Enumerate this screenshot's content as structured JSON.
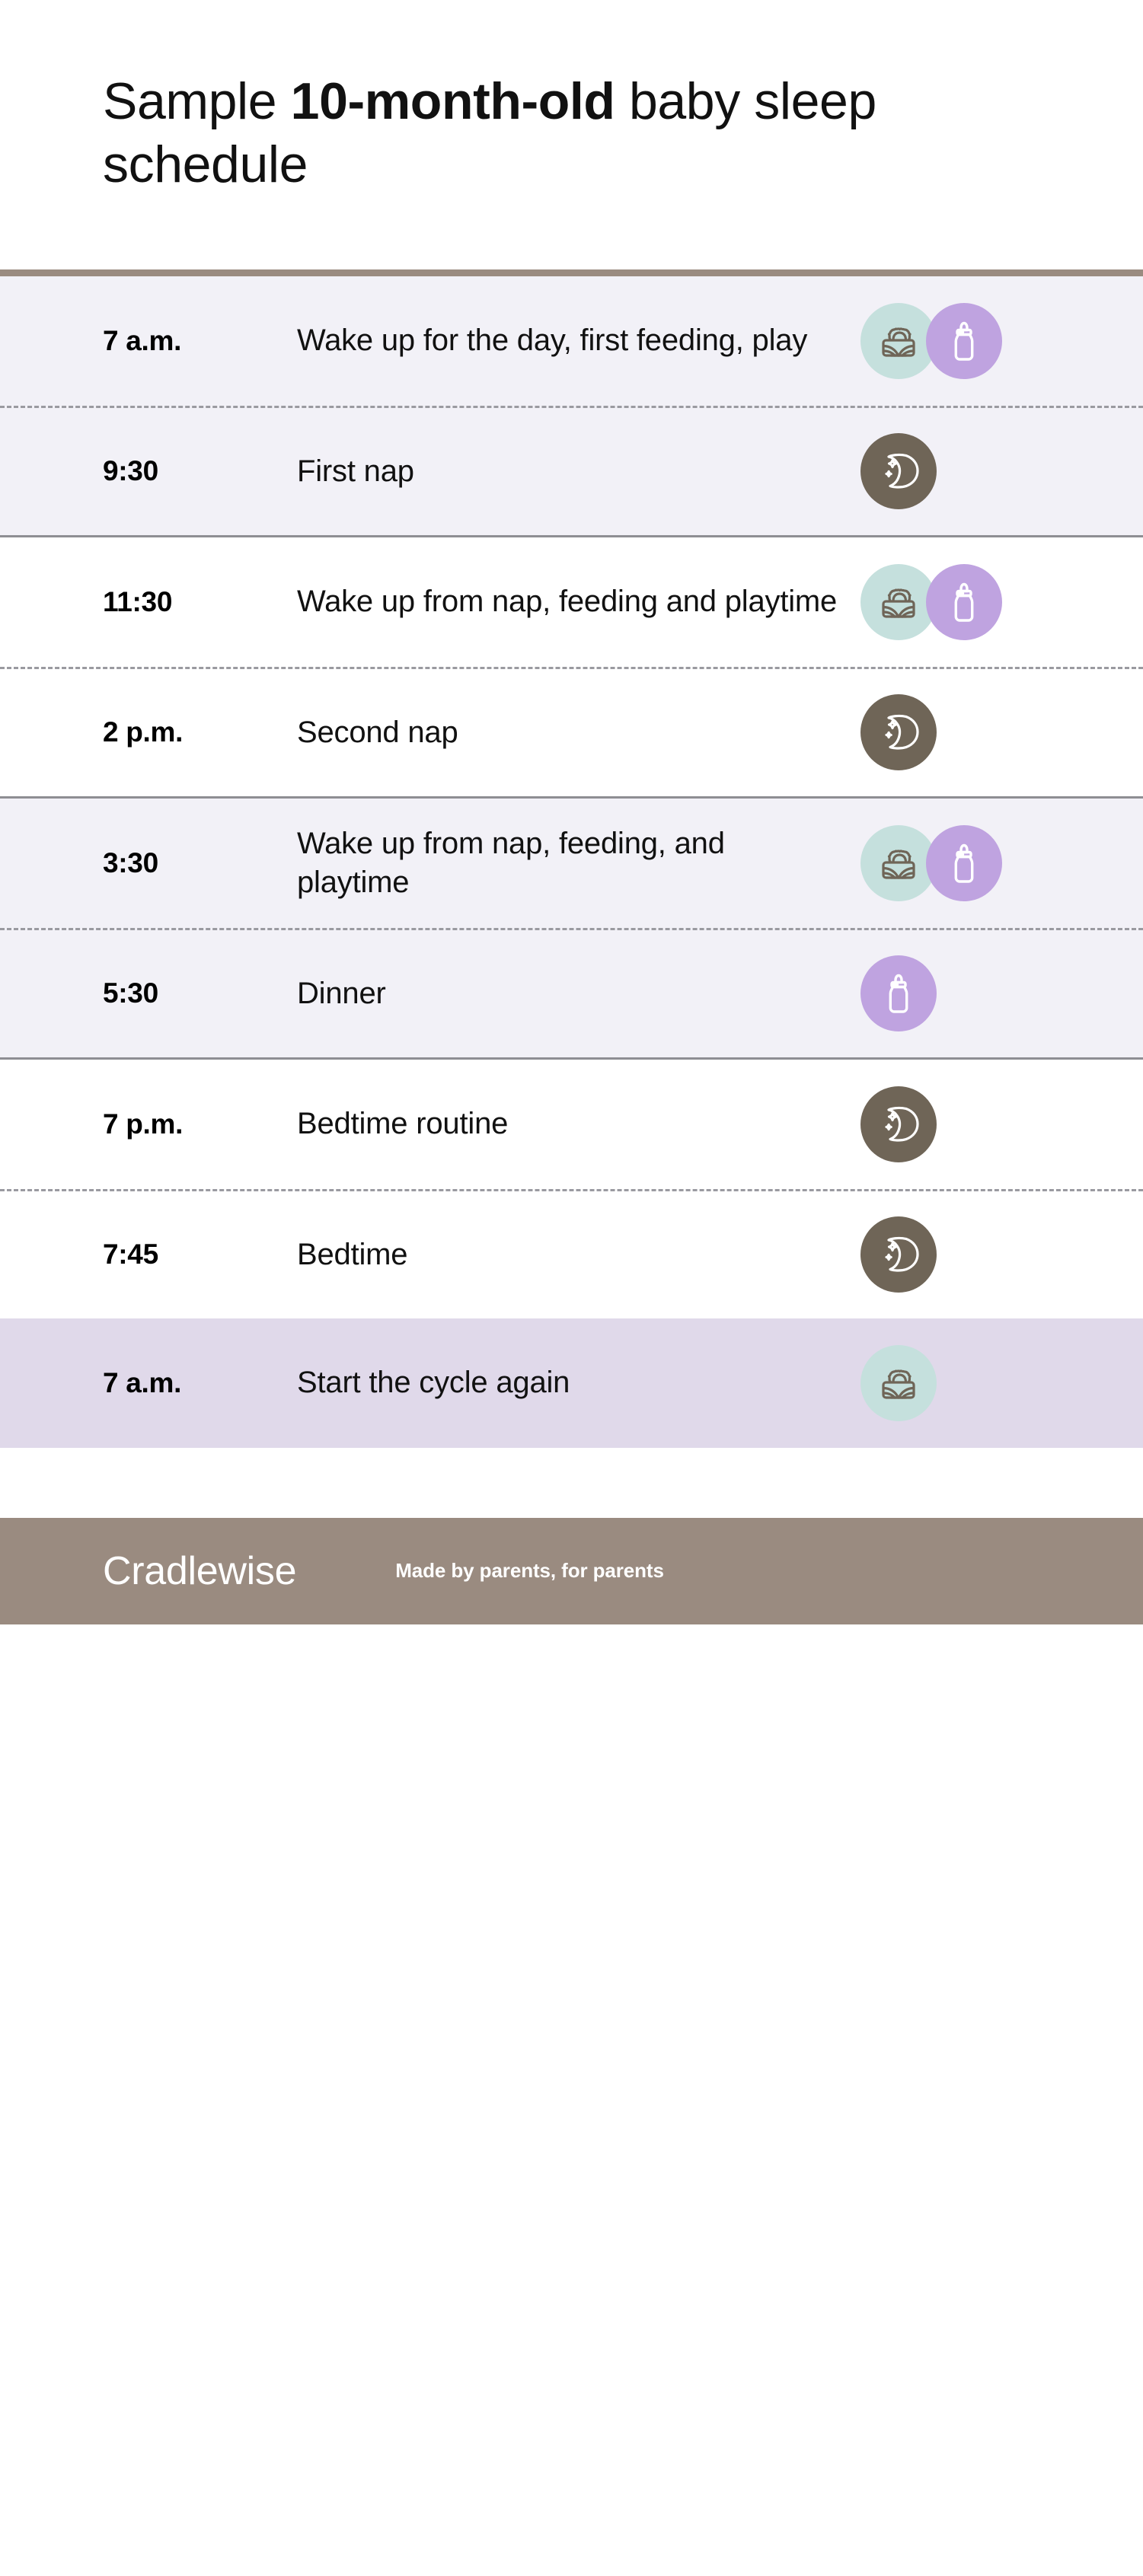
{
  "header": {
    "title_prefix": "Sample ",
    "title_bold": "10-month-old",
    "title_suffix": " baby sleep schedule"
  },
  "schedule": {
    "groups": [
      {
        "style": "shaded",
        "rows": [
          {
            "time": "7 a.m.",
            "description": "Wake up for the day, first feeding, play",
            "icons": [
              "sunrise-icon",
              "bottle-icon"
            ]
          },
          {
            "time": "9:30",
            "description": "First nap",
            "icons": [
              "moon-icon"
            ]
          }
        ]
      },
      {
        "style": "plain",
        "rows": [
          {
            "time": "11:30",
            "description": "Wake up from nap, feeding and playtime",
            "icons": [
              "sunrise-icon",
              "bottle-icon"
            ]
          },
          {
            "time": "2 p.m.",
            "description": "Second nap",
            "icons": [
              "moon-icon"
            ]
          }
        ]
      },
      {
        "style": "shaded",
        "rows": [
          {
            "time": "3:30",
            "description": "Wake up from nap, feeding, and playtime",
            "icons": [
              "sunrise-icon",
              "bottle-icon"
            ]
          },
          {
            "time": "5:30",
            "description": "Dinner",
            "icons": [
              "bottle-icon"
            ]
          }
        ]
      },
      {
        "style": "plain",
        "rows": [
          {
            "time": "7 p.m.",
            "description": "Bedtime routine",
            "icons": [
              "moon-icon"
            ]
          },
          {
            "time": "7:45",
            "description": "Bedtime",
            "icons": [
              "moon-icon"
            ]
          }
        ]
      },
      {
        "style": "accent",
        "rows": [
          {
            "time": "7 a.m.",
            "description": "Start the cycle again",
            "icons": [
              "sunrise-icon"
            ]
          }
        ]
      }
    ]
  },
  "footer": {
    "brand": "Cradlewise",
    "tagline": "Made by parents, for parents"
  },
  "colors": {
    "rule_brown": "#9a8b80",
    "row_shaded": "#f2f1f7",
    "row_accent": "#e0d9ea",
    "badge_mint": "#c5e0dd",
    "badge_purple": "#bfa3e0",
    "badge_brown": "#6f6557",
    "separator_solid": "#8e8e93",
    "separator_dashed": "#9a9aa0",
    "footer_bg": "#9a8b80"
  }
}
